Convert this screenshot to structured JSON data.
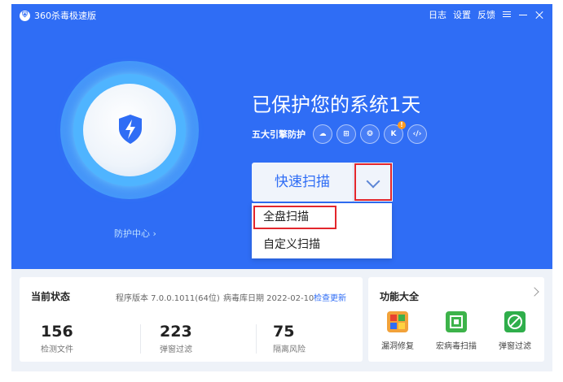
{
  "window": {
    "title": "360杀毒极速版",
    "actions": [
      "日志",
      "设置",
      "反馈"
    ]
  },
  "hero": {
    "protect_title": "已保护您的系统1天",
    "engines_label": "五大引擎防护",
    "engines": [
      {
        "name": "cloud-engine-icon",
        "glyph": "☁"
      },
      {
        "name": "windows-engine-icon",
        "glyph": "⊞"
      },
      {
        "name": "brain-engine-icon",
        "glyph": "❂"
      },
      {
        "name": "k-engine-icon",
        "glyph": "K",
        "badge": "!"
      },
      {
        "name": "code-engine-icon",
        "glyph": "‹/›"
      }
    ],
    "protection_center_link": "防护中心 ›"
  },
  "scan": {
    "main_label": "快速扫描",
    "options": [
      "全盘扫描",
      "自定义扫描"
    ]
  },
  "status": {
    "title": "当前状态",
    "program_version": "程序版本 7.0.0.1011(64位)",
    "virus_db_date": "病毒库日期 2022-02-10",
    "check_update": "检查更新",
    "stats": [
      {
        "value": "156",
        "label": "检测文件"
      },
      {
        "value": "223",
        "label": "弹窗过滤"
      },
      {
        "value": "75",
        "label": "隔离风险"
      }
    ]
  },
  "functions": {
    "title": "功能大全",
    "items": [
      {
        "label": "漏洞修复",
        "icon": "patch-fix-icon",
        "color": "#f2a23a"
      },
      {
        "label": "宏病毒扫描",
        "icon": "macro-virus-scan-icon",
        "color": "#3db34a"
      },
      {
        "label": "弹窗过滤",
        "icon": "popup-filter-icon",
        "color": "#2fae4b"
      }
    ]
  },
  "colors": {
    "accent": "#2f6df5",
    "highlight_border": "#e3262c"
  }
}
